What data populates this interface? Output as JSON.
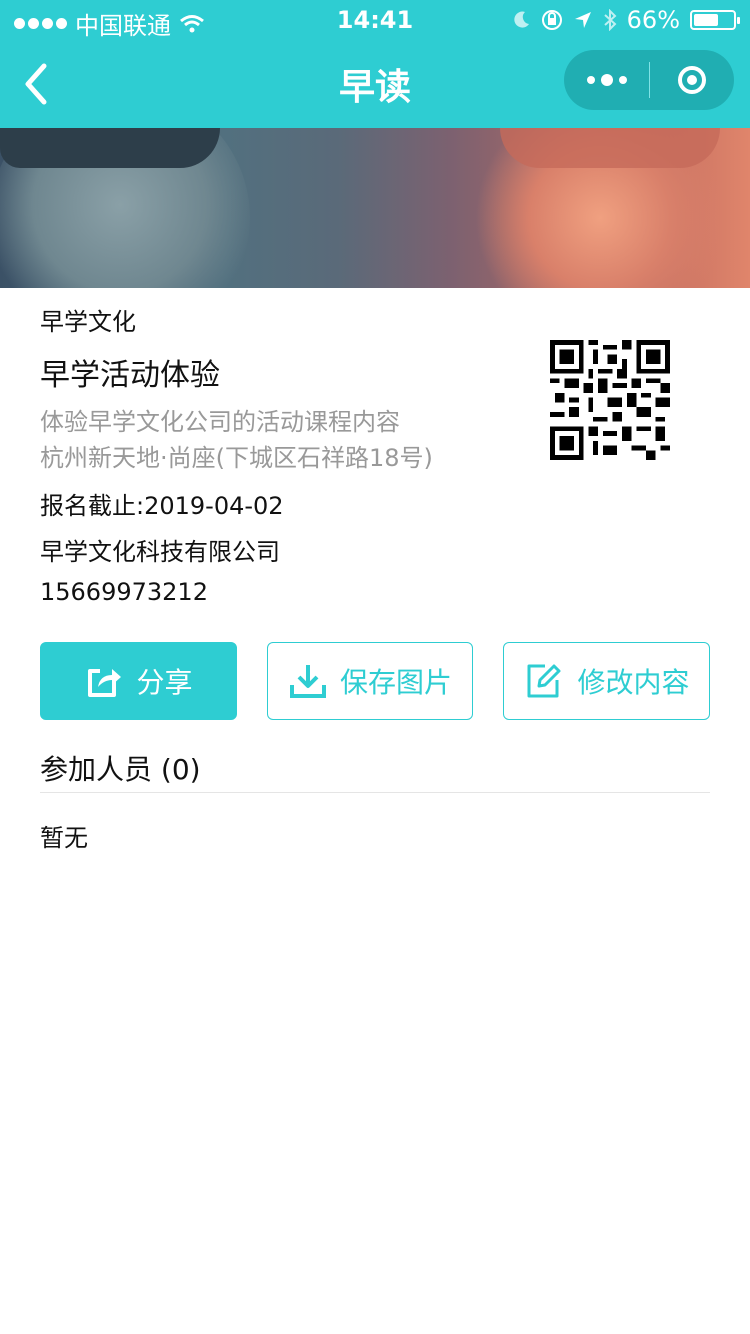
{
  "status_bar": {
    "carrier": "中国联通",
    "time": "14:41",
    "battery": "66%",
    "battery_level": 0.66
  },
  "nav": {
    "title": "早读",
    "back_icon": "chevron-left-icon",
    "more_icon": "more-dots-icon",
    "close_icon": "target-circle-icon"
  },
  "activity": {
    "organizer": "早学文化",
    "name": "早学活动体验",
    "description": "体验早学文化公司的活动课程内容",
    "address": "杭州新天地·尚座(下城区石祥路18号)",
    "deadline": "报名截止:2019-04-02",
    "company": "早学文化科技有限公司",
    "phone": "15669973212"
  },
  "actions": {
    "share_label": "分享",
    "save_label": "保存图片",
    "edit_label": "修改内容"
  },
  "participants": {
    "title": "参加人员 (0)",
    "empty_text": "暂无"
  },
  "colors": {
    "accent": "#2ecdd2",
    "capsule": "#20aeb2",
    "muted_text": "#999999"
  }
}
